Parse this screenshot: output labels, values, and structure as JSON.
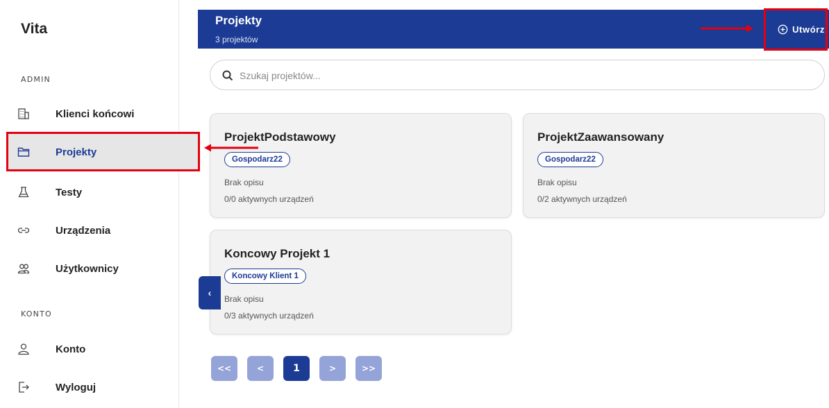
{
  "sidebar": {
    "brand": "Vita",
    "sections": [
      {
        "label": "ADMIN",
        "items": [
          {
            "label": "Klienci końcowi",
            "icon": "building-icon"
          },
          {
            "label": "Projekty",
            "icon": "folder-icon",
            "active": true
          },
          {
            "label": "Testy",
            "icon": "flask-icon"
          },
          {
            "label": "Urządzenia",
            "icon": "link-icon"
          },
          {
            "label": "Użytkownicy",
            "icon": "users-icon"
          }
        ]
      },
      {
        "label": "KONTO",
        "items": [
          {
            "label": "Konto",
            "icon": "user-icon"
          },
          {
            "label": "Wyloguj",
            "icon": "logout-icon"
          }
        ]
      }
    ]
  },
  "header": {
    "title": "Projekty",
    "subtitle": "3 projektów",
    "create_label": "Utwórz",
    "create_icon": "plus-circle-icon"
  },
  "search": {
    "placeholder": "Szukaj projektów...",
    "value": "",
    "icon": "search-icon"
  },
  "projects": [
    {
      "name": "ProjektPodstawowy",
      "client": "Gospodarz22",
      "description": "Brak opisu",
      "devices": "0/0 aktywnych urządzeń"
    },
    {
      "name": "ProjektZaawansowany",
      "client": "Gospodarz22",
      "description": "Brak opisu",
      "devices": "0/2 aktywnych urządzeń"
    },
    {
      "name": "Koncowy Projekt 1",
      "client": "Koncowy Klient 1",
      "description": "Brak opisu",
      "devices": "0/3 aktywnych urządzeń"
    }
  ],
  "collapse_button": {
    "glyph": "‹",
    "icon": "chevron-left-icon"
  },
  "pagination": {
    "first": "<<",
    "prev": "<",
    "current": "1",
    "next": ">",
    "last": ">>"
  },
  "annotations": {
    "highlight_color": "#e3000f"
  },
  "colors": {
    "primary": "#1c3b94",
    "pagination_inactive": "#95a4d8",
    "active_nav_bg": "#e6e6e6",
    "card_bg": "#f2f2f2"
  }
}
